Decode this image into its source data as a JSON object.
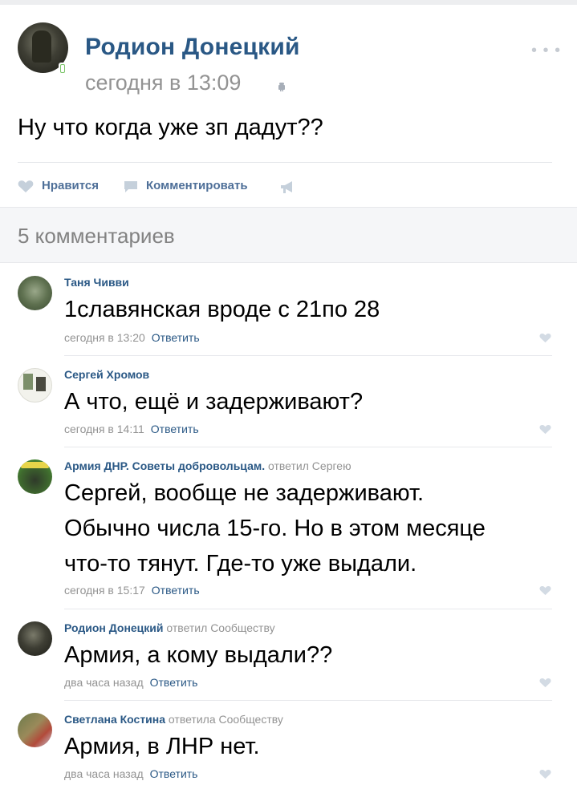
{
  "post": {
    "author": "Родион Донецкий",
    "time": "сегодня в 13:09",
    "text": "Ну что когда уже зп дадут??",
    "actions": {
      "like": "Нравится",
      "comment": "Комментировать"
    }
  },
  "comments_header": {
    "count": "5 комментариев"
  },
  "comments": [
    {
      "author": "Таня Чивви",
      "replied": "",
      "text": "1славянская вроде с 21по 28",
      "time": "сегодня в 13:20",
      "reply": "Ответить"
    },
    {
      "author": "Сергей Хромов",
      "replied": "",
      "text": "А что, ещё и задерживают?",
      "time": "сегодня в 14:11",
      "reply": "Ответить"
    },
    {
      "author": "Армия ДНР. Советы добровольцам.",
      "replied": "ответил Сергею",
      "text_lines": [
        "Сергей, вообще не задерживают.",
        "Обычно числа 15-го. Но в этом месяце",
        "что-то тянут. Где-то уже выдали."
      ],
      "time": "сегодня в 15:17",
      "reply": "Ответить"
    },
    {
      "author": "Родион Донецкий",
      "replied": "ответил Сообществу",
      "text": "Армия, а кому выдали??",
      "time": "два часа назад",
      "reply": "Ответить"
    },
    {
      "author": "Светлана Костина",
      "replied": "ответила Сообществу",
      "text": "Армия, в ЛНР нет.",
      "time": "два часа назад",
      "reply": "Ответить"
    }
  ],
  "icons": [
    "heart-icon",
    "comment-icon",
    "share-megaphone-icon",
    "more-icon",
    "android-icon",
    "mobile-icon"
  ],
  "colors": {
    "link": "#2a5885",
    "meta": "#939393",
    "icon": "#c5d0db"
  }
}
